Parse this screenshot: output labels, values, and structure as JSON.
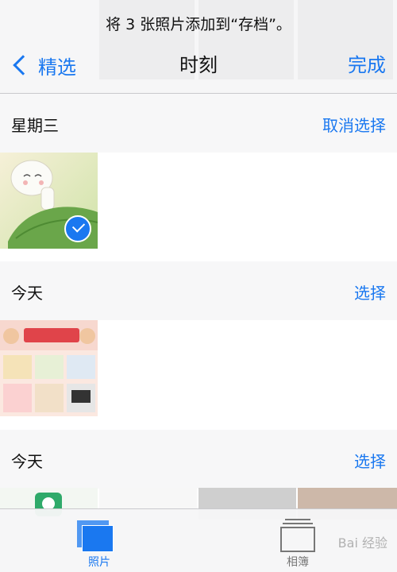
{
  "prompt": "将 3 张照片添加到“存档”。",
  "nav": {
    "back_label": "精选",
    "title": "时刻",
    "done_label": "完成"
  },
  "sections": [
    {
      "title": "星期三",
      "action": "取消选择",
      "selected": true
    },
    {
      "title": "今天",
      "action": "选择"
    },
    {
      "title": "今天",
      "action": "选择"
    }
  ],
  "tabbar": {
    "photos_label": "照片",
    "albums_label": "相簿"
  },
  "watermark": "Bai 经验",
  "colors": {
    "accent": "#1a78f0",
    "header_bg": "#f6f6f7",
    "section_bg": "#f7f7f8"
  },
  "icons": [
    "back-chevron-icon",
    "checkmark-icon",
    "photos-tab-icon",
    "albums-tab-icon"
  ]
}
